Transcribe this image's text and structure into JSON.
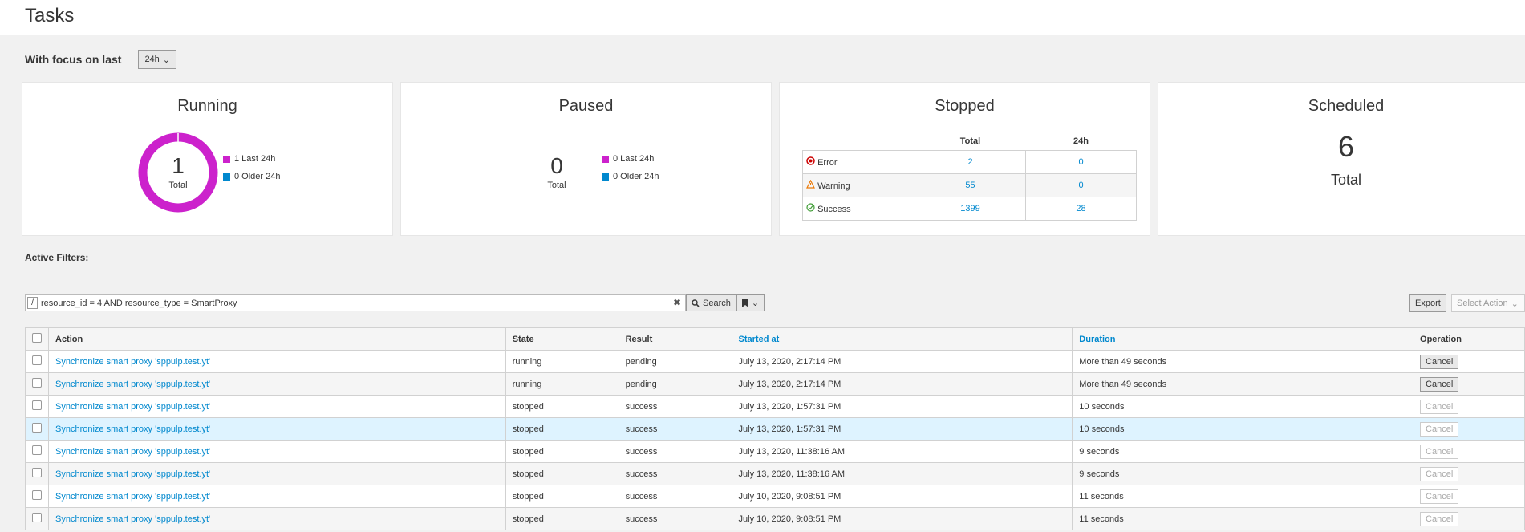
{
  "page": {
    "title": "Tasks"
  },
  "focus": {
    "label": "With focus on last",
    "value": "24h"
  },
  "colors": {
    "last24": "#cc22cc",
    "older24": "#0088ce",
    "link": "#0088ce"
  },
  "running": {
    "title": "Running",
    "count": "1",
    "sub": "Total",
    "legend": [
      "1 Last 24h",
      "0 Older 24h"
    ]
  },
  "paused": {
    "title": "Paused",
    "count": "0",
    "sub": "Total",
    "legend": [
      "0 Last 24h",
      "0 Older 24h"
    ]
  },
  "stopped": {
    "title": "Stopped",
    "col_total": "Total",
    "col_24h": "24h",
    "rows": [
      {
        "label": "Error",
        "icon": "error-circle-icon",
        "total": "2",
        "last": "0"
      },
      {
        "label": "Warning",
        "icon": "warning-triangle-icon",
        "total": "55",
        "last": "0"
      },
      {
        "label": "Success",
        "icon": "success-circle-icon",
        "total": "1399",
        "last": "28"
      }
    ]
  },
  "scheduled": {
    "title": "Scheduled",
    "count": "6",
    "sub": "Total"
  },
  "filters": {
    "label": "Active Filters:"
  },
  "search": {
    "query": "resource_id = 4 AND resource_type = SmartProxy",
    "slash": "/",
    "clear": "✖",
    "button": "Search",
    "export": "Export",
    "select_action": "Select Action"
  },
  "table": {
    "headers": {
      "action": "Action",
      "state": "State",
      "result": "Result",
      "started": "Started at",
      "duration": "Duration",
      "operation": "Operation"
    },
    "rows": [
      {
        "action": "Synchronize smart proxy 'sppulp.test.yt'",
        "state": "running",
        "result": "pending",
        "started": "July 13, 2020, 2:17:14 PM",
        "duration": "More than 49 seconds",
        "op": "Cancel"
      },
      {
        "action": "Synchronize smart proxy 'sppulp.test.yt'",
        "state": "running",
        "result": "pending",
        "started": "July 13, 2020, 2:17:14 PM",
        "duration": "More than 49 seconds",
        "op": "Cancel"
      },
      {
        "action": "Synchronize smart proxy 'sppulp.test.yt'",
        "state": "stopped",
        "result": "success",
        "started": "July 13, 2020, 1:57:31 PM",
        "duration": "10 seconds",
        "op": "Cancel"
      },
      {
        "action": "Synchronize smart proxy 'sppulp.test.yt'",
        "state": "stopped",
        "result": "success",
        "started": "July 13, 2020, 1:57:31 PM",
        "duration": "10 seconds",
        "op": "Cancel"
      },
      {
        "action": "Synchronize smart proxy 'sppulp.test.yt'",
        "state": "stopped",
        "result": "success",
        "started": "July 13, 2020, 11:38:16 AM",
        "duration": "9 seconds",
        "op": "Cancel"
      },
      {
        "action": "Synchronize smart proxy 'sppulp.test.yt'",
        "state": "stopped",
        "result": "success",
        "started": "July 13, 2020, 11:38:16 AM",
        "duration": "9 seconds",
        "op": "Cancel"
      },
      {
        "action": "Synchronize smart proxy 'sppulp.test.yt'",
        "state": "stopped",
        "result": "success",
        "started": "July 10, 2020, 9:08:51 PM",
        "duration": "11 seconds",
        "op": "Cancel"
      },
      {
        "action": "Synchronize smart proxy 'sppulp.test.yt'",
        "state": "stopped",
        "result": "success",
        "started": "July 10, 2020, 9:08:51 PM",
        "duration": "11 seconds",
        "op": "Cancel"
      }
    ]
  }
}
